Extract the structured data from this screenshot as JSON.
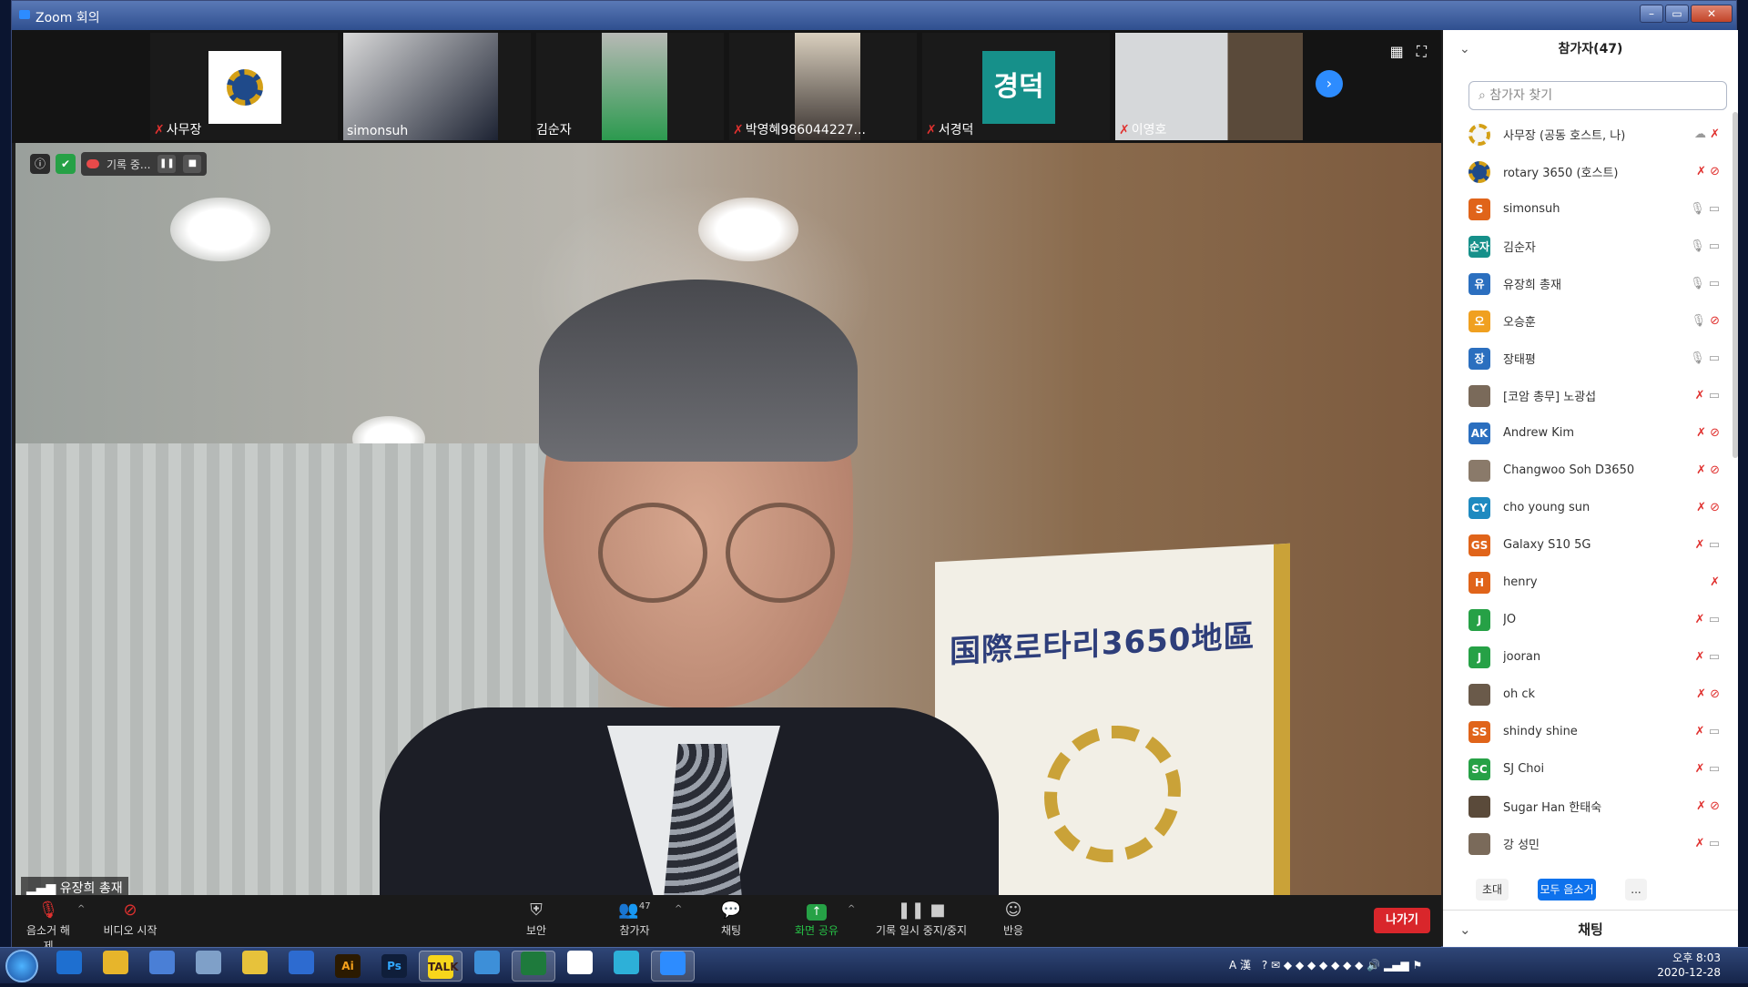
{
  "window": {
    "title": "Zoom 회의"
  },
  "strip": {
    "tiles": [
      {
        "name": "사무장",
        "muted": true
      },
      {
        "name": "simonsuh",
        "muted": false
      },
      {
        "name": "김순자",
        "muted": false
      },
      {
        "name": "박영혜986044227...",
        "muted": true
      },
      {
        "name": "서경덕",
        "muted": true,
        "initial": "경덕"
      },
      {
        "name": "이영호",
        "muted": true
      }
    ]
  },
  "main": {
    "speaker_name": "유장희 총재",
    "banner_text": "国際로타리3650地區",
    "recording_label": "기록 중...",
    "signal_icon": "signal-bars-icon"
  },
  "toolbar": {
    "unmute": "음소거 해제",
    "start_video": "비디오 시작",
    "security": "보안",
    "participants": "참가자",
    "participants_count": "47",
    "chat": "채팅",
    "share": "화면 공유",
    "record_control": "기록 일시 중지/중지",
    "reactions": "반응",
    "leave": "나가기"
  },
  "panel": {
    "title": "참가자(47)",
    "search_placeholder": "참가자 찾기",
    "participants": [
      {
        "initial": "",
        "name": "사무장 (공동 호스트, 나)",
        "color": "#f5f5f5",
        "rotary": true,
        "mic": "muted",
        "video": "cloud"
      },
      {
        "initial": "",
        "name": "rotary 3650 (호스트)",
        "color": "#1f4a8a",
        "rotary": true,
        "mic": "muted",
        "video": "off"
      },
      {
        "initial": "S",
        "name": "simonsuh",
        "color": "#e0641a",
        "mic": "on",
        "video": "on"
      },
      {
        "initial": "순자",
        "name": "김순자",
        "color": "#16908a",
        "mic": "on",
        "video": "on"
      },
      {
        "initial": "유",
        "name": "유장희 총재",
        "color": "#2b6fbf",
        "mic": "on",
        "video": "on"
      },
      {
        "initial": "오",
        "name": "오승훈",
        "color": "#f0a020",
        "mic": "on",
        "video": "off"
      },
      {
        "initial": "장",
        "name": "장태평",
        "color": "#2b6fbf",
        "mic": "on",
        "video": "on"
      },
      {
        "initial": "",
        "name": "[코암 총무] 노광섭",
        "color": "#7a6a5a",
        "mic": "muted",
        "video": "on"
      },
      {
        "initial": "AK",
        "name": "Andrew Kim",
        "color": "#2b6fbf",
        "mic": "muted",
        "video": "off"
      },
      {
        "initial": "",
        "name": "Changwoo Soh D3650",
        "color": "#8a7a6a",
        "mic": "muted",
        "video": "off"
      },
      {
        "initial": "CY",
        "name": "cho young sun",
        "color": "#1f8ac0",
        "mic": "muted",
        "video": "off"
      },
      {
        "initial": "GS",
        "name": "Galaxy S10 5G",
        "color": "#e0641a",
        "mic": "muted",
        "video": "on"
      },
      {
        "initial": "H",
        "name": "henry",
        "color": "#e0641a",
        "mic": "muted",
        "video": ""
      },
      {
        "initial": "J",
        "name": "JO",
        "color": "#26a146",
        "mic": "muted",
        "video": "on"
      },
      {
        "initial": "J",
        "name": "jooran",
        "color": "#26a146",
        "mic": "muted",
        "video": "on"
      },
      {
        "initial": "",
        "name": "oh ck",
        "color": "#6a5a4a",
        "mic": "muted",
        "video": "off"
      },
      {
        "initial": "SS",
        "name": "shindy shine",
        "color": "#e0641a",
        "mic": "muted",
        "video": "on"
      },
      {
        "initial": "SC",
        "name": "SJ Choi",
        "color": "#26a146",
        "mic": "muted",
        "video": "on"
      },
      {
        "initial": "",
        "name": "Sugar Han 한태숙",
        "color": "#5a4a3a",
        "mic": "muted",
        "video": "off"
      },
      {
        "initial": "",
        "name": "강 성민",
        "color": "#7a6a5a",
        "mic": "muted",
        "video": "on"
      }
    ],
    "invite": "초대",
    "mute_all": "모두 음소거",
    "more": "...",
    "chat_title": "채팅"
  },
  "taskbar": {
    "apps": [
      "ie-icon",
      "folder-icon",
      "app-icon",
      "app-icon",
      "folder-icon",
      "w-icon",
      "Ai",
      "Ps",
      "TALK",
      "app-icon",
      "excel-icon",
      "chrome-icon",
      "app-icon",
      "zoom-icon"
    ],
    "ime": "A 漢",
    "time": "오후 8:03",
    "date": "2020-12-28"
  }
}
